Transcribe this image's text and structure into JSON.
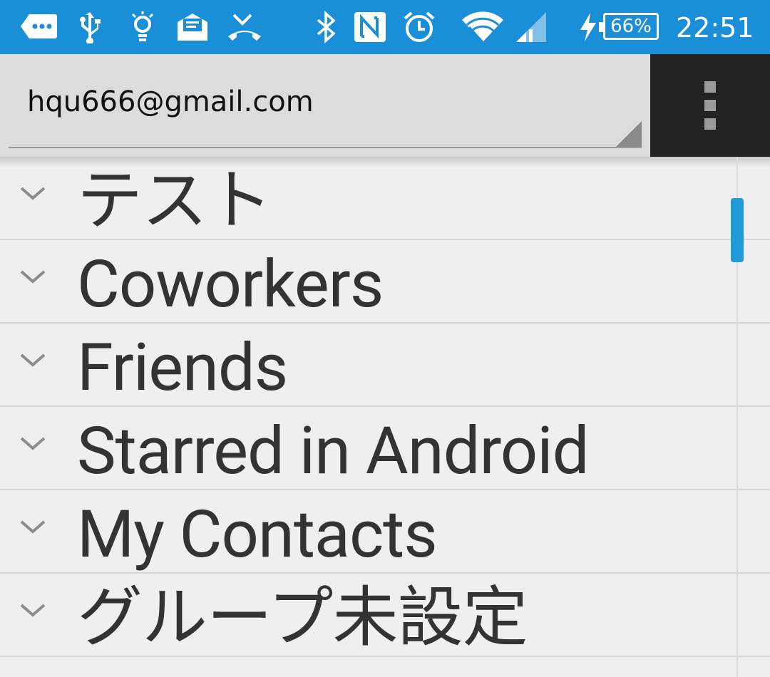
{
  "status_bar": {
    "battery_percent": "66%",
    "time": "22:51",
    "icons": [
      "chat-bubble-icon",
      "usb-icon",
      "lightbulb-icon",
      "email-icon",
      "missed-call-icon",
      "bluetooth-icon",
      "nfc-icon",
      "alarm-icon",
      "wifi-icon",
      "cell-signal-icon",
      "charging-bolt-icon"
    ]
  },
  "toolbar": {
    "account": "hqu666@gmail.com"
  },
  "groups": [
    {
      "label": "テスト"
    },
    {
      "label": "Coworkers"
    },
    {
      "label": "Friends"
    },
    {
      "label": "Starred in Android"
    },
    {
      "label": "My Contacts"
    },
    {
      "label": "グループ未設定"
    }
  ],
  "colors": {
    "status_bar": "#1a8fd8",
    "toolbar": "#dcdcdc",
    "overflow_bg": "#222222",
    "accent_scroll": "#1f9bd9",
    "list_bg": "#efefef"
  }
}
